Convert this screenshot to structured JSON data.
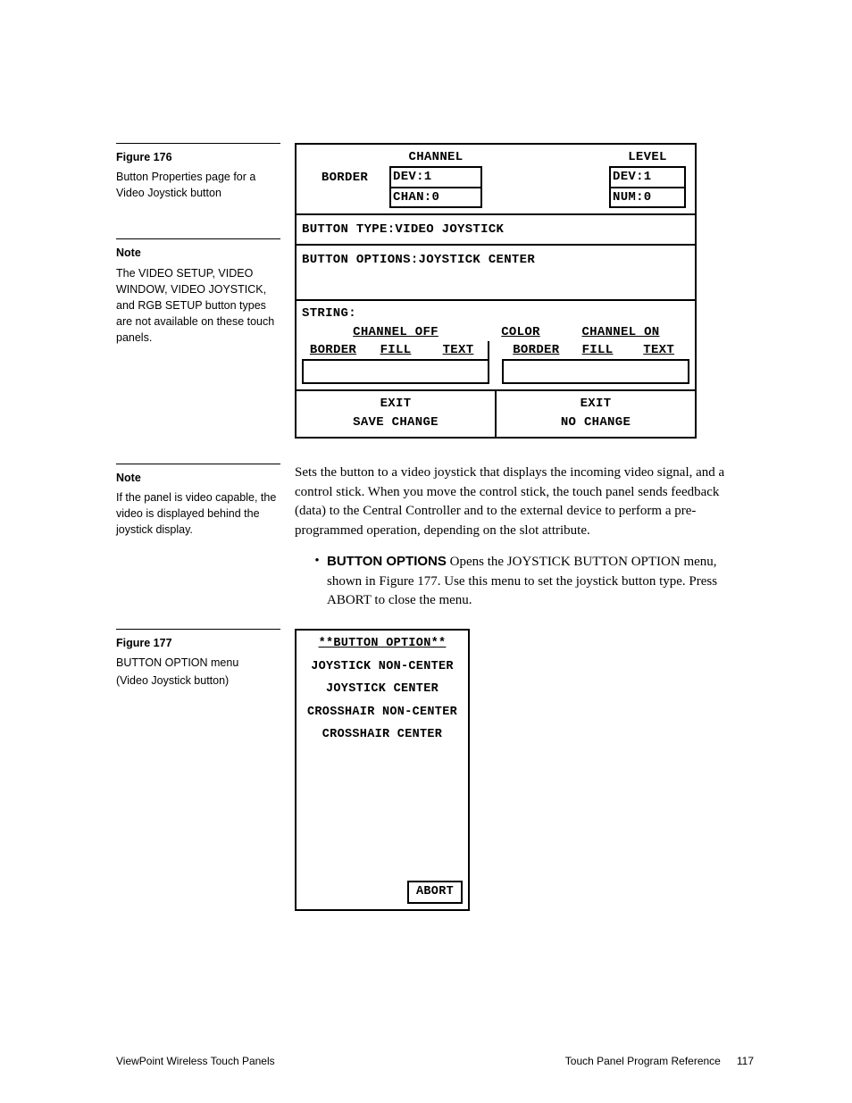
{
  "fig176": {
    "label": "Figure 176",
    "caption": "Button Properties page for a Video Joystick button",
    "panel": {
      "border_label": "BORDER",
      "channel_hdr": "CHANNEL",
      "channel_dev": "DEV:1",
      "channel_chan": "CHAN:0",
      "level_hdr": "LEVEL",
      "level_dev": "DEV:1",
      "level_num": "NUM:0",
      "btn_type": "BUTTON TYPE:VIDEO JOYSTICK",
      "btn_options": "BUTTON OPTIONS:JOYSTICK CENTER",
      "string_label": "STRING:",
      "ch_off": "CHANNEL OFF",
      "color": "COLOR",
      "ch_on": "CHANNEL ON",
      "c_border": "BORDER",
      "c_fill": "FILL",
      "c_text": "TEXT",
      "exit_save1": "EXIT",
      "exit_save2": "SAVE CHANGE",
      "exit_no1": "EXIT",
      "exit_no2": "NO CHANGE"
    }
  },
  "note1": {
    "label": "Note",
    "text": "The VIDEO SETUP, VIDEO WINDOW, VIDEO JOYSTICK, and RGB SETUP button types are not available on these touch panels."
  },
  "note2": {
    "label": "Note",
    "text": "If the panel is video capable, the video is displayed behind the joystick display."
  },
  "body1": "Sets the button to a video joystick that displays the incoming video signal, and a control stick. When you move the control stick, the touch panel sends feedback (data) to the Central Controller and to the external device to perform a pre-programmed operation, depending on the slot attribute.",
  "bullet1": {
    "lead": "BUTTON OPTIONS",
    "rest": "   Opens the JOYSTICK BUTTON OPTION menu, shown in Figure 177. Use this menu to set the joystick button type. Press ABORT to close the menu."
  },
  "fig177": {
    "label": "Figure 177",
    "caption1": "BUTTON OPTION menu",
    "caption2": "(Video Joystick button)",
    "panel": {
      "title": "**BUTTON OPTION**",
      "o1": "JOYSTICK NON-CENTER",
      "o2": "JOYSTICK CENTER",
      "o3": "CROSSHAIR NON-CENTER",
      "o4": "CROSSHAIR CENTER",
      "abort": "ABORT"
    }
  },
  "footer": {
    "left": "ViewPoint Wireless Touch Panels",
    "right1": "Touch Panel Program Reference",
    "right2": "117"
  }
}
